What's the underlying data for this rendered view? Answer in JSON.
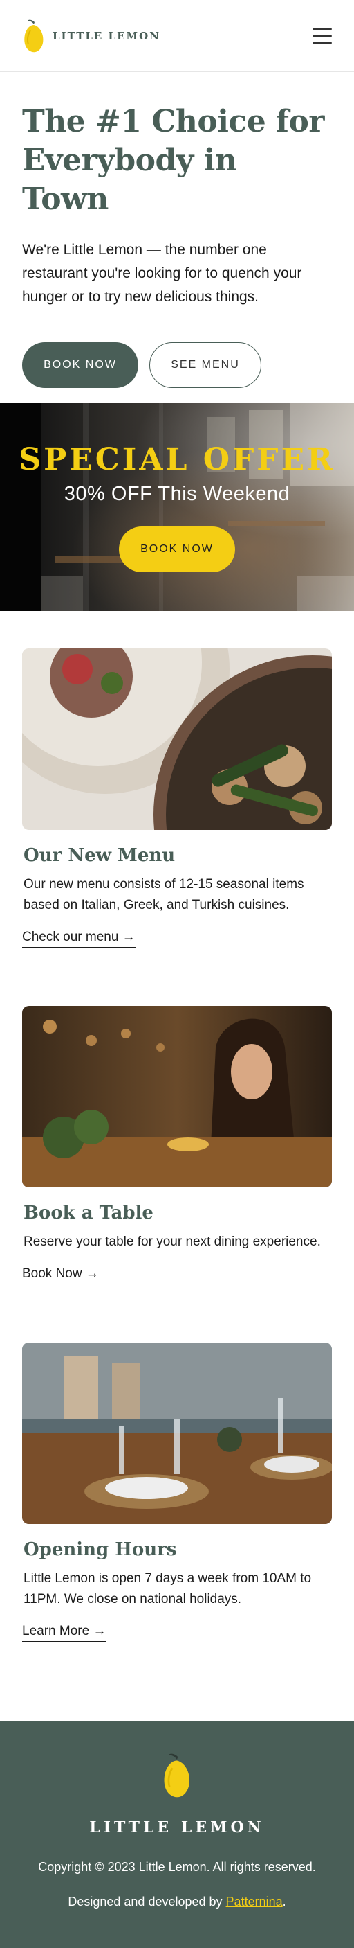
{
  "header": {
    "brand": "LITTLE LEMON",
    "menu_icon": "hamburger-menu-icon"
  },
  "hero": {
    "title": "The #1 Choice for Everybody in Town",
    "text": "We're Little Lemon — the number one restaurant you're looking for to quench your hunger or to try new delicious things.",
    "book_label": "BOOK NOW",
    "menu_label": "SEE MENU"
  },
  "offer": {
    "title": "SPECIAL OFFER",
    "subtitle": "30% OFF This Weekend",
    "button_label": "BOOK NOW"
  },
  "cards": [
    {
      "title": "Our New Menu",
      "text": "Our new menu consists of 12-15 seasonal items based on Italian, Greek, and Turkish cuisines.",
      "link": "Check our menu →"
    },
    {
      "title": "Book a Table",
      "text": "Reserve your table for your next dining experience.",
      "link": "Book Now →"
    },
    {
      "title": "Opening Hours",
      "text": "Little Lemon is open 7 days a week from 10AM to 11PM. We close on national holidays.",
      "link": "Learn More →"
    }
  ],
  "footer": {
    "brand": "LITTLE LEMON",
    "copyright": "Copyright © 2023 Little Lemon. All rights reserved.",
    "credit_prefix": "Designed and developed by ",
    "credit_link": "Patternina",
    "credit_suffix": "."
  },
  "colors": {
    "primary_green": "#495e57",
    "lemon_yellow": "#f4ce14",
    "white": "#ffffff"
  }
}
